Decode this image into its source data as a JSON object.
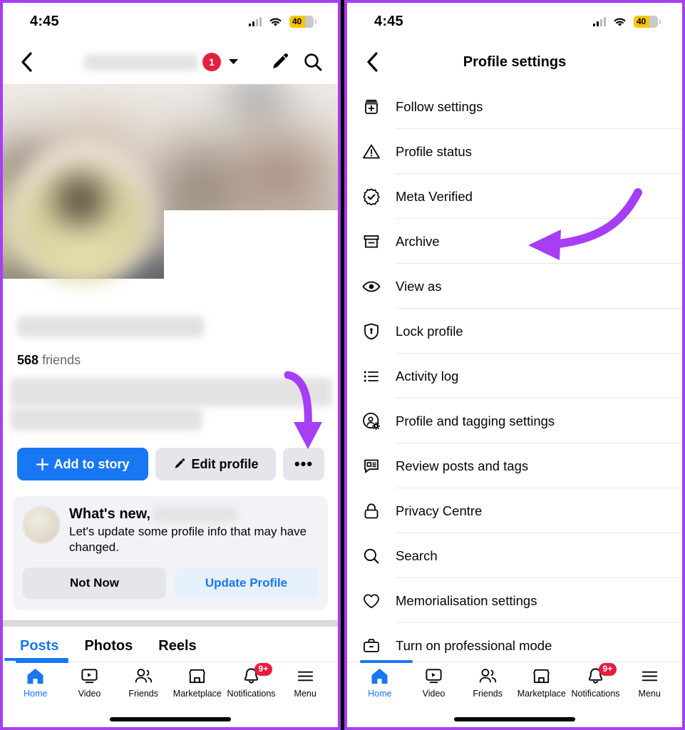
{
  "theme": {
    "accent_blue": "#1877f2",
    "annotation_purple": "#a63ef5",
    "badge_red": "#e41e3f",
    "battery_yellow": "#f7c600",
    "surface_grey": "#e4e6eb"
  },
  "left_phone": {
    "status_bar": {
      "time": "4:45",
      "battery_level": "40",
      "wifi": "wifi-icon",
      "cellular": "cellular-icon"
    },
    "header": {
      "back_icon": "chevron-left-icon",
      "name_redacted": "",
      "notification_count": "1",
      "caret_icon": "caret-down-icon",
      "edit_icon": "pencil-icon",
      "search_icon": "search-icon"
    },
    "profile": {
      "cover_photo": "blurred-cover-photo",
      "avatar": "blurred-profile-avatar",
      "name_redacted": "",
      "friends_count": "568",
      "friends_label": "friends",
      "bio_redacted": ""
    },
    "actions": {
      "add_to_story": "Add to story",
      "add_icon": "plus-icon",
      "edit_profile": "Edit profile",
      "edit_icon": "pencil-icon",
      "more": "•••"
    },
    "whats_new_card": {
      "title": "What's new,",
      "name_redacted": "",
      "body": "Let's update some profile info that may have changed.",
      "not_now": "Not Now",
      "update_profile": "Update Profile"
    },
    "tabs": [
      {
        "label": "Posts",
        "active": true
      },
      {
        "label": "Photos",
        "active": false
      },
      {
        "label": "Reels",
        "active": false
      }
    ],
    "bottom_nav": [
      {
        "label": "Home",
        "icon": "home-icon",
        "active": true,
        "badge": ""
      },
      {
        "label": "Video",
        "icon": "video-icon",
        "active": false,
        "badge": ""
      },
      {
        "label": "Friends",
        "icon": "friends-icon",
        "active": false,
        "badge": ""
      },
      {
        "label": "Marketplace",
        "icon": "marketplace-icon",
        "active": false,
        "badge": ""
      },
      {
        "label": "Notifications",
        "icon": "bell-icon",
        "active": false,
        "badge": "9+"
      },
      {
        "label": "Menu",
        "icon": "hamburger-icon",
        "active": false,
        "badge": ""
      }
    ]
  },
  "right_phone": {
    "status_bar": {
      "time": "4:45",
      "battery_level": "40",
      "wifi": "wifi-icon",
      "cellular": "cellular-icon"
    },
    "header": {
      "back_icon": "chevron-left-icon",
      "title": "Profile settings"
    },
    "settings": [
      {
        "label": "Follow settings",
        "icon": "follow-settings-icon"
      },
      {
        "label": "Profile status",
        "icon": "warning-triangle-icon"
      },
      {
        "label": "Meta Verified",
        "icon": "verified-badge-icon"
      },
      {
        "label": "Archive",
        "icon": "archive-box-icon"
      },
      {
        "label": "View as",
        "icon": "eye-icon"
      },
      {
        "label": "Lock profile",
        "icon": "shield-lock-icon"
      },
      {
        "label": "Activity log",
        "icon": "list-icon"
      },
      {
        "label": "Profile and tagging settings",
        "icon": "profile-gear-icon"
      },
      {
        "label": "Review posts and tags",
        "icon": "review-chat-icon"
      },
      {
        "label": "Privacy Centre",
        "icon": "padlock-icon"
      },
      {
        "label": "Search",
        "icon": "search-icon"
      },
      {
        "label": "Memorialisation settings",
        "icon": "heart-icon"
      },
      {
        "label": "Turn on professional mode",
        "icon": "briefcase-icon"
      }
    ],
    "bottom_nav": [
      {
        "label": "Home",
        "icon": "home-icon",
        "active": true,
        "badge": ""
      },
      {
        "label": "Video",
        "icon": "video-icon",
        "active": false,
        "badge": ""
      },
      {
        "label": "Friends",
        "icon": "friends-icon",
        "active": false,
        "badge": ""
      },
      {
        "label": "Marketplace",
        "icon": "marketplace-icon",
        "active": false,
        "badge": ""
      },
      {
        "label": "Notifications",
        "icon": "bell-icon",
        "active": false,
        "badge": "9+"
      },
      {
        "label": "Menu",
        "icon": "hamburger-icon",
        "active": false,
        "badge": ""
      }
    ]
  },
  "annotations": [
    {
      "name": "arrow-pointing-to-more-button",
      "shape": "curved-down-arrow",
      "color": "#a63ef5"
    },
    {
      "name": "arrow-pointing-to-archive",
      "shape": "curved-left-arrow",
      "color": "#a63ef5"
    }
  ]
}
